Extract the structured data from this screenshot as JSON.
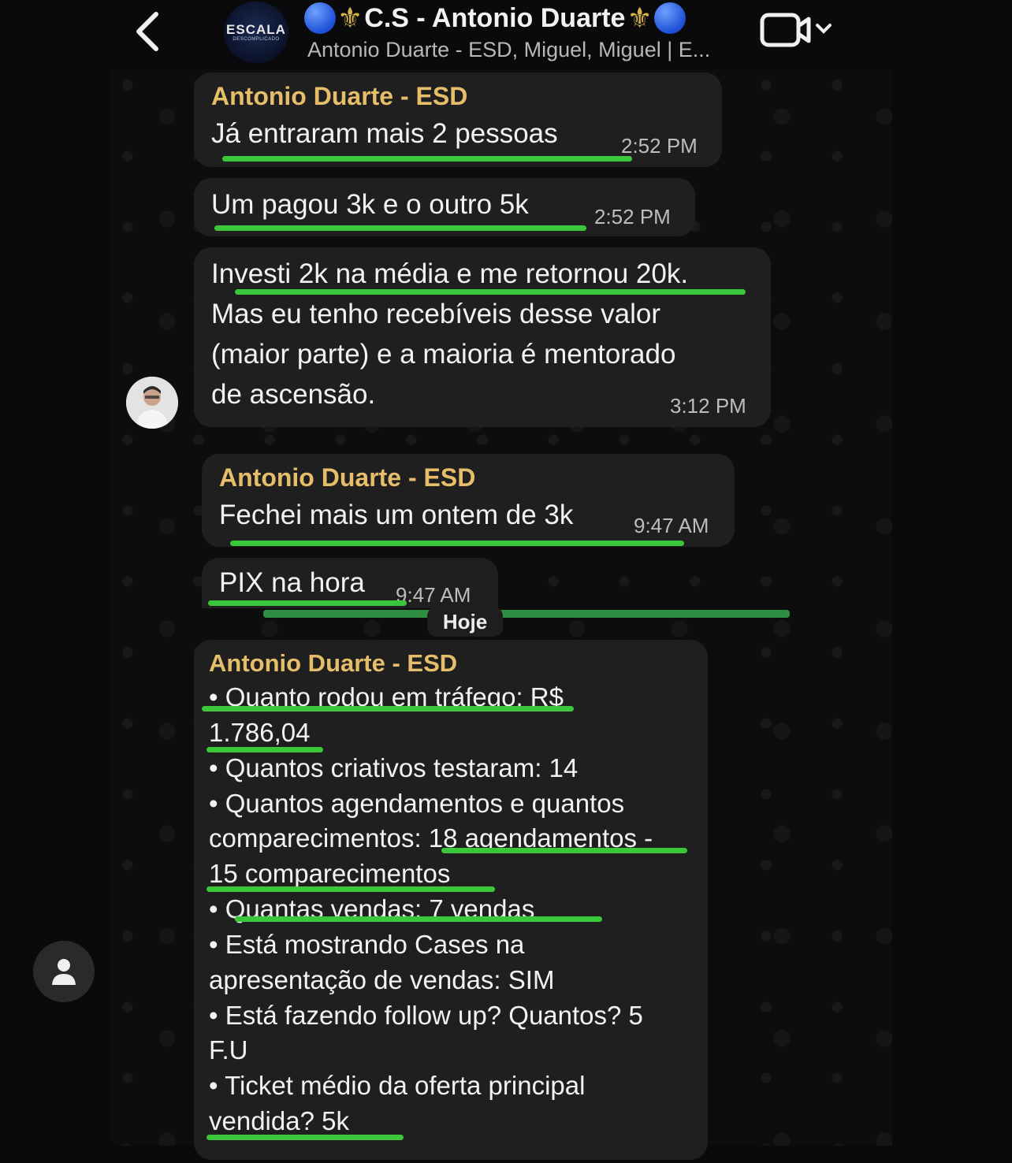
{
  "header": {
    "group_avatar_text": "ESCALA",
    "group_avatar_subtext": "DESCOMPLICADO",
    "title": "C.S - Antonio Duarte",
    "subtitle": "Antonio Duarte - ESD, Miguel, Miguel | E..."
  },
  "messages": [
    {
      "sender": "Antonio Duarte - ESD",
      "text": "Já entraram mais 2 pessoas",
      "time": "2:52 PM"
    },
    {
      "text": "Um pagou 3k e o outro 5k",
      "time": "2:52 PM"
    },
    {
      "lines": [
        "Investi 2k na média e me retornou 20k.",
        "Mas eu tenho recebíveis desse valor",
        "(maior parte) e a maioria é mentorado",
        "de ascensão."
      ],
      "time": "3:12 PM"
    },
    {
      "sender": "Antonio Duarte - ESD",
      "text": "Fechei mais um ontem de 3k",
      "time": "9:47 AM"
    },
    {
      "text": "PIX na hora",
      "time": "9:47 AM"
    }
  ],
  "day_separator": "Hoje",
  "report": {
    "sender": "Antonio Duarte - ESD",
    "lines": [
      "•  Quanto rodou em tráfego: R$",
      "1.786,04",
      "•  Quantos criativos testaram: 14",
      "•  Quantos agendamentos e quantos",
      "comparecimentos: 18 agendamentos -",
      "15 comparecimentos",
      "•  Quantas vendas: 7 vendas",
      "•  Está mostrando Cases na",
      "apresentação de vendas: SIM",
      "•  Está fazendo follow up? Quantos? 5",
      "F.U",
      "•  Ticket médio da oferta principal",
      "vendida? 5k"
    ]
  },
  "colors": {
    "highlight": "#3cc63c",
    "sender": "#e6be6a",
    "bubble": "#1f1f1f"
  },
  "icons": [
    "back-chevron-icon",
    "video-call-icon",
    "chevron-down-icon",
    "person-icon"
  ]
}
